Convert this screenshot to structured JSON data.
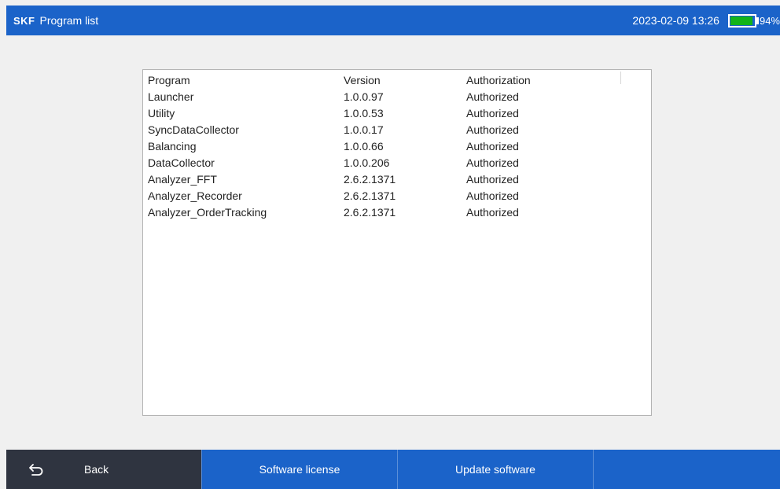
{
  "header": {
    "logo": "SKF",
    "title": "Program list",
    "datetime": "2023-02-09 13:26",
    "battery_percent": "94%",
    "battery_level": 0.94,
    "battery_color": "#11b31a"
  },
  "table": {
    "headers": [
      "Program",
      "Version",
      "Authorization"
    ],
    "rows": [
      [
        "Launcher",
        "1.0.0.97",
        "Authorized"
      ],
      [
        "Utility",
        "1.0.0.53",
        "Authorized"
      ],
      [
        "SyncDataCollector",
        "1.0.0.17",
        "Authorized"
      ],
      [
        "Balancing",
        "1.0.0.66",
        "Authorized"
      ],
      [
        "DataCollector",
        "1.0.0.206",
        "Authorized"
      ],
      [
        "Analyzer_FFT",
        "2.6.2.1371",
        "Authorized"
      ],
      [
        "Analyzer_Recorder",
        "2.6.2.1371",
        "Authorized"
      ],
      [
        "Analyzer_OrderTracking",
        "2.6.2.1371",
        "Authorized"
      ]
    ]
  },
  "footer": {
    "back_label": "Back",
    "back_icon": "back-arrow-icon",
    "license_label": "Software license",
    "update_label": "Update software",
    "empty_label": ""
  },
  "colors": {
    "accent": "#1b63c9",
    "back_bg": "#2f3440"
  }
}
